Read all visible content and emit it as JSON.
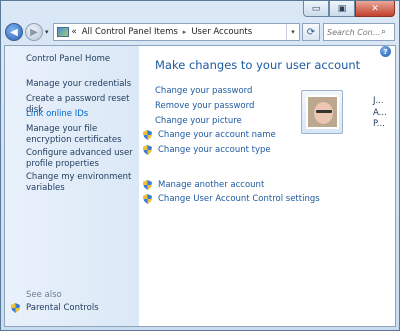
{
  "window": {
    "caption_buttons": {
      "minimize": "▭",
      "maximize": "▣",
      "close": "✕"
    }
  },
  "navbar": {
    "back_glyph": "◀",
    "forward_glyph": "▶",
    "recent_glyph": "▾",
    "address": {
      "chevrons": "«",
      "crumbs": [
        "All Control Panel Items",
        "User Accounts"
      ],
      "separator": "▸",
      "dropdown_glyph": "▾"
    },
    "refresh_glyph": "⟳",
    "search": {
      "placeholder": "Search Con...",
      "icon": "search-icon",
      "glyph": "⌕"
    }
  },
  "sidebar": {
    "home": "Control Panel Home",
    "links": [
      "Manage your credentials",
      "Create a password reset disk",
      "Link online IDs",
      "Manage your file encryption certificates",
      "Configure advanced user profile properties",
      "Change my environment variables"
    ],
    "see_also": "See also",
    "parental_controls": "Parental Controls"
  },
  "main": {
    "title": "Make changes to your user account",
    "help_glyph": "?",
    "tasks": [
      {
        "label": "Change your password",
        "shield": false
      },
      {
        "label": "Remove your password",
        "shield": false
      },
      {
        "label": "Change your picture",
        "shield": false
      },
      {
        "label": "Change your account name",
        "shield": true
      },
      {
        "label": "Change your account type",
        "shield": true
      }
    ],
    "tasks2": [
      {
        "label": "Manage another account",
        "shield": true
      },
      {
        "label": "Change User Account Control settings",
        "shield": true
      }
    ],
    "user": {
      "line1": "J...",
      "line2": "A...",
      "line3": "P..."
    }
  },
  "colors": {
    "link": "#1e5aa0",
    "sidebar_text": "#1e395b",
    "accent": "#0066cc"
  }
}
